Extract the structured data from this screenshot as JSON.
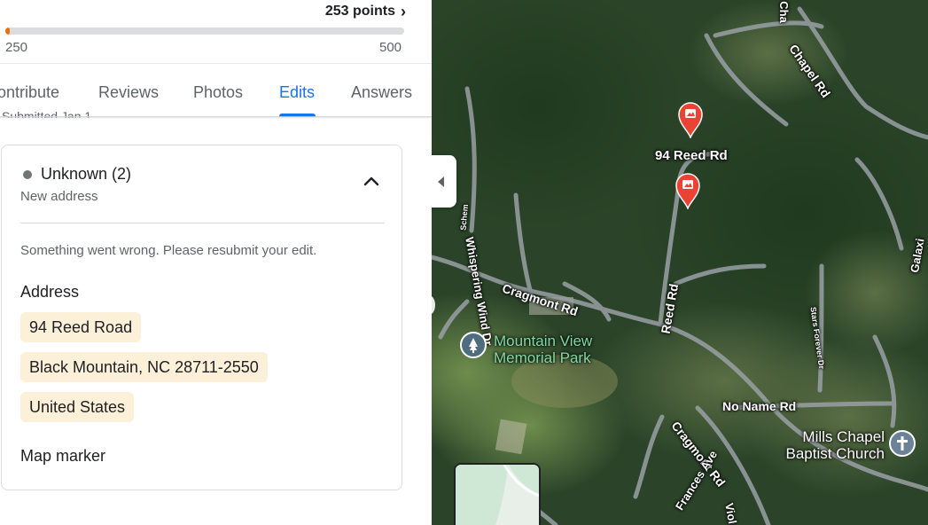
{
  "progress": {
    "points_label": "253 points",
    "min": "250",
    "max": "500",
    "fill_fraction": 0.012,
    "fill_color": "#e8710a"
  },
  "tabs": [
    {
      "label": "ontribute",
      "active": false
    },
    {
      "label": "Reviews",
      "active": false
    },
    {
      "label": "Photos",
      "active": false
    },
    {
      "label": "Edits",
      "active": true
    },
    {
      "label": "Answers",
      "active": false
    }
  ],
  "submitted_text": "Submitted Jan 1",
  "edit_card": {
    "status_title": "Unknown (2)",
    "status_subtitle": "New address",
    "error_message": "Something went wrong. Please resubmit your edit.",
    "address_heading": "Address",
    "address_lines": [
      "94 Reed Road",
      "Black Mountain, NC 28711-2550",
      "United States"
    ],
    "map_marker_heading": "Map marker"
  },
  "map": {
    "pin_label": "94 Reed Rd",
    "poi_park": "Mountain View\nMemorial Park",
    "poi_church": "Mills Chapel\nBaptist Church",
    "roads": {
      "chapel_rd": "Chapel Rd",
      "cha_top": "Cha",
      "whispering_wind": "Whispering Wind Dr",
      "cragmont_rd": "Cragmont Rd",
      "cragmont_rd_2": "Cragmont Rd",
      "reed_rd": "Reed Rd",
      "no_name_rd": "No Name Rd",
      "frances_ave": "Frances Ave",
      "stars_forever": "Stars Forever Dr",
      "galaxy": "Galaxi",
      "scheme": "Schem",
      "viol": "Viol"
    },
    "colors": {
      "pin": "#ea4335",
      "park_icon": "#4e6e80",
      "church_icon": "#6b8299",
      "accent": "#1a73e8"
    }
  }
}
